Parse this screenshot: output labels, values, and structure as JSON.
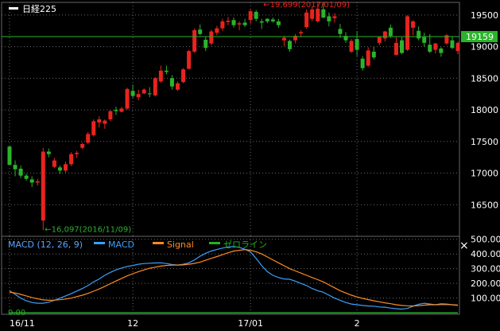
{
  "colors": {
    "background": "#000000",
    "up": "#e8241e",
    "down": "#2bb32b",
    "grid": "#6a6a6a",
    "axis_text": "#ffffff",
    "price_line": "#2bb32b",
    "price_tag_bg": "#2bb32b",
    "annotation_high": "#e8241e",
    "annotation_low": "#2bb32b",
    "macd": "#3aa0ff",
    "signal": "#ff8a20",
    "zero": "#22b022",
    "legend_title": "#5aa5ff"
  },
  "close_button_glyph": "×",
  "chart_data": [
    {
      "type": "candlestick",
      "title": "日経225",
      "ylim": [
        16000,
        19700
      ],
      "y_ticks": [
        16500,
        17000,
        17500,
        18000,
        18500,
        19000,
        19500
      ],
      "y_tick_labels": [
        "16500",
        "17000",
        "17500",
        "18000",
        "18500",
        "19000",
        "19500"
      ],
      "x_labels": [
        {
          "index": 0,
          "label": "16/11"
        },
        {
          "index": 22,
          "label": "12"
        },
        {
          "index": 43,
          "label": "17/01"
        },
        {
          "index": 62,
          "label": "2"
        }
      ],
      "current_price": 19159,
      "current_price_label": "19159",
      "annotations": {
        "high": {
          "index": 45,
          "value": 19699,
          "text": "←19,699(2017/01/09)"
        },
        "low": {
          "index": 6,
          "value": 16097,
          "text": "←16,097(2016/11/09)"
        }
      },
      "candles": [
        [
          17420,
          17440,
          17270,
          17130
        ],
        [
          17130,
          17200,
          16950,
          17060
        ],
        [
          17070,
          17120,
          16920,
          16960
        ],
        [
          16960,
          16990,
          16880,
          16910
        ],
        [
          16900,
          16950,
          16780,
          16850
        ],
        [
          16850,
          16910,
          16800,
          16870
        ],
        [
          16250,
          17400,
          16097,
          17340
        ],
        [
          17340,
          17390,
          17250,
          17300
        ],
        [
          17100,
          17240,
          17080,
          17200
        ],
        [
          17090,
          17120,
          16990,
          17040
        ],
        [
          17040,
          17180,
          17010,
          17140
        ],
        [
          17140,
          17330,
          17110,
          17300
        ],
        [
          17300,
          17350,
          17240,
          17320
        ],
        [
          17400,
          17480,
          17380,
          17460
        ],
        [
          17480,
          17650,
          17460,
          17620
        ],
        [
          17600,
          17850,
          17580,
          17820
        ],
        [
          17800,
          17900,
          17720,
          17850
        ],
        [
          17780,
          17850,
          17700,
          17830
        ],
        [
          17850,
          17990,
          17820,
          17980
        ],
        [
          18000,
          18050,
          17920,
          17980
        ],
        [
          17970,
          18050,
          17960,
          18020
        ],
        [
          18020,
          18350,
          18000,
          18330
        ],
        [
          18300,
          18400,
          18190,
          18220
        ],
        [
          18200,
          18320,
          18150,
          18250
        ],
        [
          18260,
          18340,
          18250,
          18320
        ],
        [
          18260,
          18360,
          18200,
          18250
        ],
        [
          18230,
          18520,
          18210,
          18500
        ],
        [
          18450,
          18700,
          18430,
          18620
        ],
        [
          18620,
          18700,
          18560,
          18600
        ],
        [
          18500,
          18550,
          18320,
          18370
        ],
        [
          18320,
          18450,
          18300,
          18420
        ],
        [
          18440,
          18660,
          18420,
          18640
        ],
        [
          18650,
          18950,
          18640,
          18930
        ],
        [
          18920,
          19290,
          18900,
          19260
        ],
        [
          19270,
          19350,
          19180,
          19200
        ],
        [
          19110,
          19150,
          18930,
          18980
        ],
        [
          19050,
          19270,
          19020,
          19240
        ],
        [
          19220,
          19330,
          19180,
          19290
        ],
        [
          19290,
          19440,
          19250,
          19400
        ],
        [
          19390,
          19470,
          19340,
          19410
        ],
        [
          19420,
          19460,
          19300,
          19340
        ],
        [
          19350,
          19400,
          19260,
          19370
        ],
        [
          19380,
          19440,
          19310,
          19340
        ],
        [
          19420,
          19600,
          19360,
          19560
        ],
        [
          19550,
          19580,
          19400,
          19440
        ],
        [
          19400,
          19440,
          19280,
          19380
        ],
        [
          19440,
          19450,
          19370,
          19400
        ],
        [
          19430,
          19460,
          19380,
          19400
        ],
        [
          19400,
          19440,
          19300,
          19340
        ],
        [
          19100,
          19170,
          19010,
          19140
        ],
        [
          19090,
          19110,
          18920,
          18960
        ],
        [
          19100,
          19200,
          19050,
          19170
        ],
        [
          19210,
          19260,
          19150,
          19230
        ],
        [
          19310,
          19590,
          19280,
          19540
        ],
        [
          19440,
          19640,
          19400,
          19590
        ],
        [
          19400,
          19690,
          19380,
          19600
        ],
        [
          19590,
          19699,
          19450,
          19460
        ],
        [
          19480,
          19540,
          19320,
          19400
        ],
        [
          19450,
          19530,
          19380,
          19480
        ],
        [
          19280,
          19360,
          19140,
          19200
        ],
        [
          19170,
          19230,
          19060,
          19100
        ],
        [
          18920,
          19120,
          18900,
          19090
        ],
        [
          19120,
          19240,
          18850,
          18950
        ],
        [
          18810,
          18850,
          18620,
          18660
        ],
        [
          18700,
          18990,
          18680,
          18940
        ],
        [
          18920,
          19000,
          18800,
          18830
        ],
        [
          19060,
          19160,
          19020,
          19150
        ],
        [
          19130,
          19250,
          19080,
          19240
        ],
        [
          19300,
          19350,
          19140,
          19170
        ],
        [
          18870,
          19150,
          18860,
          19060
        ],
        [
          19100,
          19150,
          18880,
          18900
        ],
        [
          18950,
          19500,
          18930,
          19480
        ],
        [
          19300,
          19420,
          19180,
          19400
        ],
        [
          19250,
          19320,
          19100,
          19130
        ],
        [
          19150,
          19220,
          19000,
          19060
        ],
        [
          19030,
          19200,
          18900,
          18920
        ],
        [
          18950,
          19060,
          18890,
          19050
        ],
        [
          18970,
          18990,
          18840,
          18900
        ],
        [
          19050,
          19200,
          19030,
          19180
        ],
        [
          19100,
          19160,
          18960,
          18980
        ],
        [
          18930,
          19080,
          18880,
          19060
        ]
      ]
    },
    {
      "type": "line",
      "title": "MACD (12, 26, 9)",
      "ylim": [
        -10,
        520
      ],
      "y_ticks": [
        100,
        200,
        300,
        400,
        500
      ],
      "y_tick_labels": [
        "100.00",
        "200.00",
        "300.00",
        "400.00",
        "500.00"
      ],
      "zero_label": "0.00",
      "series": [
        {
          "name": "MACD",
          "values": [
            150,
            125,
            100,
            82,
            70,
            65,
            65,
            72,
            85,
            100,
            115,
            130,
            148,
            165,
            185,
            210,
            230,
            255,
            275,
            292,
            305,
            315,
            322,
            330,
            335,
            337,
            339,
            340,
            335,
            328,
            325,
            330,
            340,
            360,
            385,
            405,
            420,
            430,
            440,
            448,
            450,
            445,
            432,
            414,
            370,
            320,
            280,
            255,
            240,
            230,
            228,
            215,
            200,
            185,
            165,
            150,
            140,
            120,
            100,
            85,
            70,
            60,
            55,
            50,
            47,
            45,
            40,
            38,
            32,
            28,
            25,
            30,
            45,
            58,
            65,
            60,
            55,
            62,
            60,
            55,
            50
          ]
        },
        {
          "name": "Signal",
          "values": [
            140,
            135,
            125,
            115,
            104,
            95,
            88,
            85,
            86,
            89,
            94,
            100,
            110,
            120,
            132,
            147,
            162,
            180,
            198,
            216,
            234,
            251,
            266,
            280,
            292,
            303,
            310,
            318,
            322,
            324,
            325,
            326,
            330,
            336,
            345,
            357,
            370,
            382,
            395,
            408,
            420,
            425,
            430,
            425,
            415,
            400,
            380,
            360,
            340,
            320,
            300,
            285,
            270,
            255,
            240,
            225,
            210,
            190,
            170,
            150,
            135,
            120,
            108,
            98,
            90,
            82,
            75,
            68,
            62,
            55,
            50,
            48,
            47,
            49,
            52,
            55,
            55,
            56,
            56,
            55,
            53
          ]
        },
        {
          "name": "ゼロライン",
          "values": [
            0,
            0,
            0,
            0,
            0,
            0,
            0,
            0,
            0,
            0,
            0,
            0,
            0,
            0,
            0,
            0,
            0,
            0,
            0,
            0,
            0,
            0,
            0,
            0,
            0,
            0,
            0,
            0,
            0,
            0,
            0,
            0,
            0,
            0,
            0,
            0,
            0,
            0,
            0,
            0,
            0,
            0,
            0,
            0,
            0,
            0,
            0,
            0,
            0,
            0,
            0,
            0,
            0,
            0,
            0,
            0,
            0,
            0,
            0,
            0,
            0,
            0,
            0,
            0,
            0,
            0,
            0,
            0,
            0,
            0,
            0,
            0,
            0,
            0,
            0,
            0,
            0,
            0,
            0,
            0,
            0
          ]
        }
      ],
      "x_labels": [
        {
          "index": 0,
          "label": "16/11"
        },
        {
          "index": 22,
          "label": "12"
        },
        {
          "index": 43,
          "label": "17/01"
        },
        {
          "index": 62,
          "label": "2"
        }
      ]
    }
  ]
}
